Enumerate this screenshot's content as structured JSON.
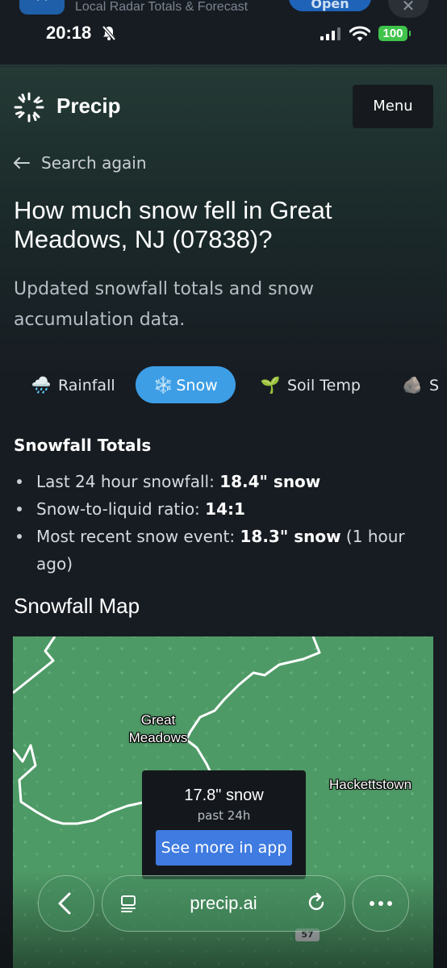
{
  "banner": {
    "text": "Local Radar Totals & Forecast",
    "open_label": "Open",
    "close_label": "✕"
  },
  "status": {
    "time": "20:18",
    "battery": "100"
  },
  "header": {
    "brand": "Precip",
    "menu_label": "Menu"
  },
  "nav": {
    "back_label": "Search again"
  },
  "page": {
    "title": "How much snow fell in Great Meadows, NJ (07838)?",
    "subtitle": "Updated snowfall totals and snow accumulation data."
  },
  "tabs": [
    {
      "icon": "🌧️",
      "label": "Rainfall",
      "active": false
    },
    {
      "icon": "❄️",
      "label": "Snow",
      "active": true
    },
    {
      "icon": "🌱",
      "label": "Soil Temp",
      "active": false
    },
    {
      "icon": "🪨",
      "label": "S",
      "active": false
    }
  ],
  "totals": {
    "heading": "Snowfall Totals",
    "items": [
      {
        "label": "Last 24 hour snowfall: ",
        "value": "18.4\" snow",
        "suffix": ""
      },
      {
        "label": "Snow-to-liquid ratio: ",
        "value": "14:1",
        "suffix": ""
      },
      {
        "label": "Most recent snow event: ",
        "value": "18.3\" snow",
        "suffix": " (1 hour ago)"
      }
    ]
  },
  "map": {
    "heading": "Snowfall Map",
    "cities": [
      "Great Meadows",
      "Hackettstown"
    ],
    "popup": {
      "value": "17.8\" snow",
      "period": "past 24h",
      "button": "See more in app"
    },
    "route_shield": "57",
    "fill_color": "#4e9a66"
  },
  "browser": {
    "url": "precip.ai"
  },
  "colors": {
    "accent": "#3d9ee6",
    "button": "#3f7be0",
    "background": "#171c22"
  }
}
